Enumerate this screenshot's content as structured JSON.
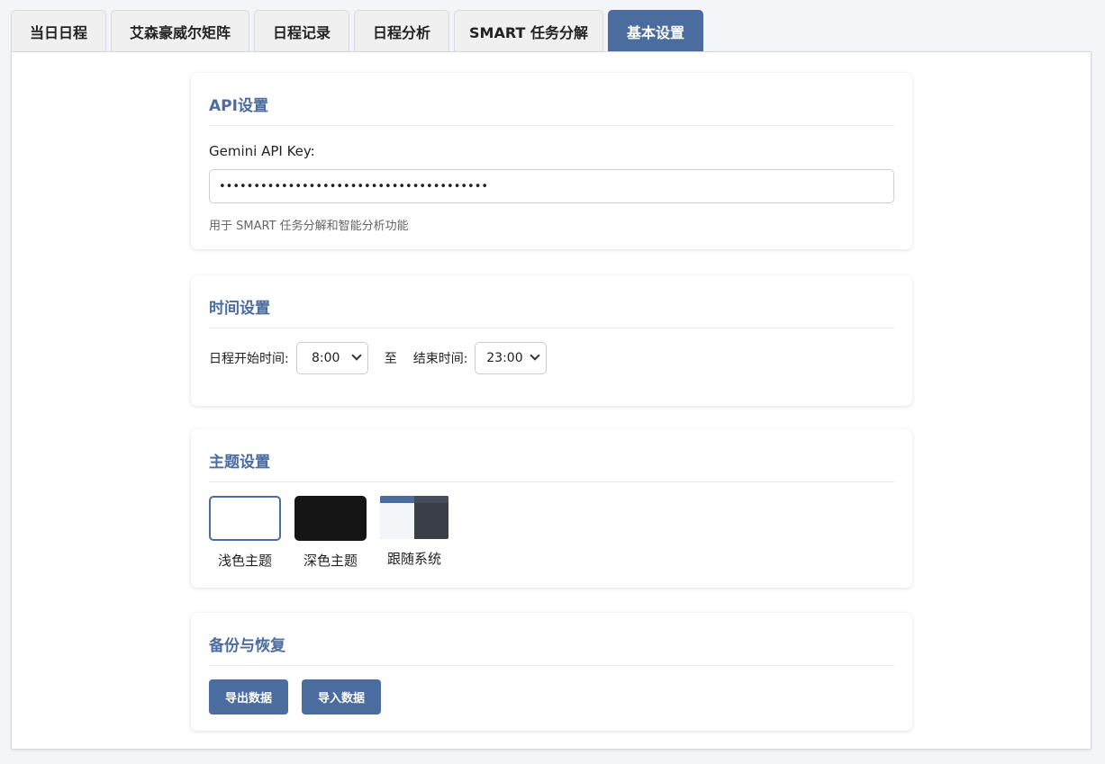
{
  "tabs": [
    {
      "label": "当日日程"
    },
    {
      "label": "艾森豪威尔矩阵"
    },
    {
      "label": "日程记录"
    },
    {
      "label": "日程分析"
    },
    {
      "label": "SMART 任务分解"
    },
    {
      "label": "基本设置",
      "active": true
    }
  ],
  "api": {
    "title": "API设置",
    "key_label": "Gemini API Key:",
    "key_value": "•••••••••••••••••••••••••••••••••••••••",
    "hint": "用于 SMART 任务分解和智能分析功能"
  },
  "time": {
    "title": "时间设置",
    "start_label": "日程开始时间:",
    "start_value": "8:00",
    "to": "至",
    "end_label": "结束时间:",
    "end_value": "23:00"
  },
  "theme": {
    "title": "主题设置",
    "options": [
      {
        "label": "浅色主题",
        "selected": true
      },
      {
        "label": "深色主题"
      },
      {
        "label": "跟随系统"
      }
    ]
  },
  "backup": {
    "title": "备份与恢复",
    "export_label": "导出数据",
    "import_label": "导入数据"
  },
  "colors": {
    "accent": "#4a6c9e",
    "background": "#f4f5f9",
    "dark_swatch": "#151515"
  }
}
